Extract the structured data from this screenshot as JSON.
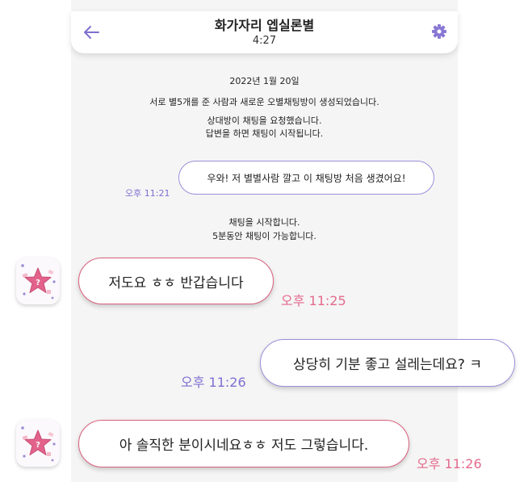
{
  "header": {
    "title": "화가자리 엡실론별",
    "subtitle": "4:27"
  },
  "system": {
    "date": "2022년 1월 20일",
    "created": "서로 별5개를 준 사람과 새로운 오별채팅방이 생성되었습니다.",
    "requested": "상대방이 채팅을 요청했습니다.",
    "reply_hint": "답변을 하면 채팅이 시작됩니다.",
    "started": "채팅을 시작합니다.",
    "duration": "5분동안 채팅이 가능합니다."
  },
  "messages": [
    {
      "text": "우와! 저 별별사람 깔고 이 채팅방 처음 생겼어요!",
      "time": "오후 11:21",
      "sender": "me"
    },
    {
      "text": "저도요 ㅎㅎ 반갑습니다",
      "time": "오후 11:25",
      "sender": "partner"
    },
    {
      "text": "상당히 기분 좋고 설레는데요? ㅋ",
      "time": "오후 11:26",
      "sender": "me"
    },
    {
      "text": "아 솔직한 분이시네요ㅎㅎ 저도 그렇습니다.",
      "time": "오후 11:26",
      "sender": "partner"
    }
  ],
  "icons": {
    "back": "arrow-left-icon",
    "settings": "gear-icon",
    "avatar": "star-question-icon"
  },
  "colors": {
    "accent": "#7d6fd1",
    "partner": "#d9607e",
    "partner_time": "#e46a8c",
    "background": "#f5f5f5"
  }
}
